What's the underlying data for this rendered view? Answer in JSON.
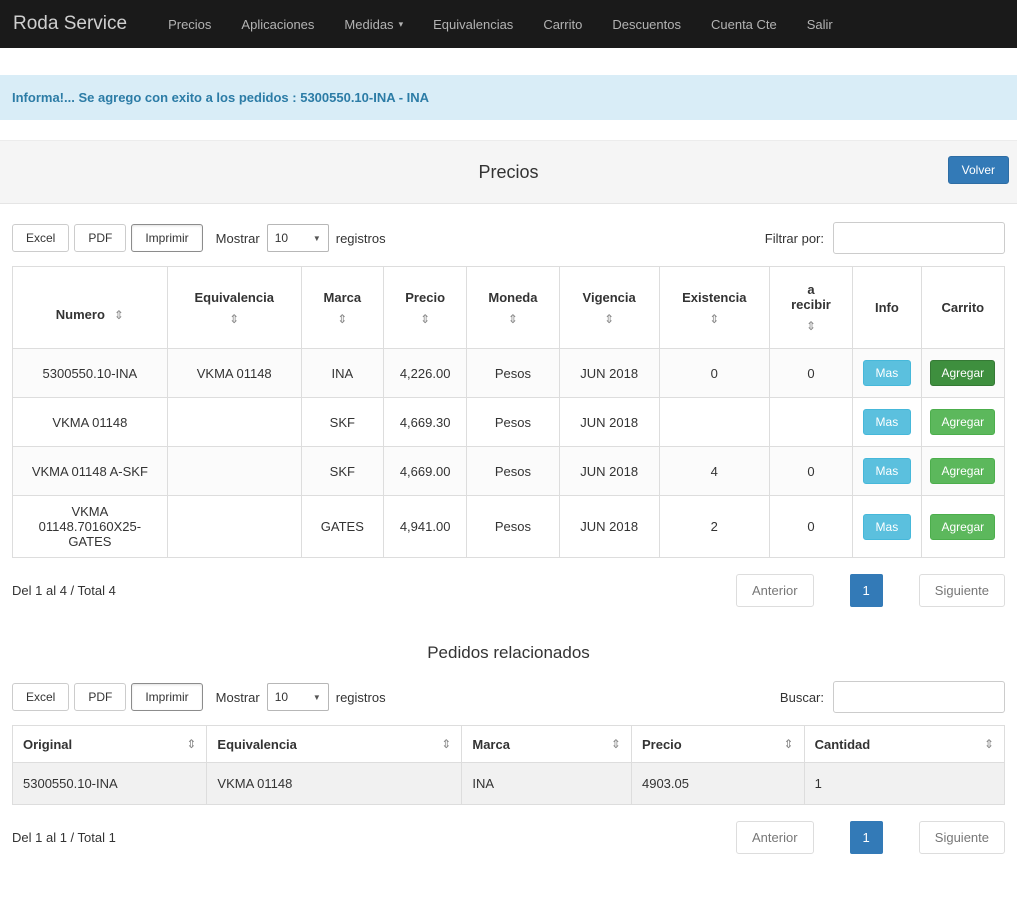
{
  "icons": {
    "caret_down": "▾",
    "select_arrow": "▼",
    "sort": "⇕"
  },
  "navbar": {
    "brand": "Roda Service",
    "items": [
      {
        "label": "Precios"
      },
      {
        "label": "Aplicaciones"
      },
      {
        "label": "Medidas"
      },
      {
        "label": "Equivalencias"
      },
      {
        "label": "Carrito"
      },
      {
        "label": "Descuentos"
      },
      {
        "label": "Cuenta Cte"
      },
      {
        "label": "Salir"
      }
    ]
  },
  "alert": {
    "message": "Informa!... Se agrego con exito a los pedidos : 5300550.10-INA - INA"
  },
  "precios": {
    "title": "Precios",
    "volver_label": "Volver",
    "toolbar": {
      "excel": "Excel",
      "pdf": "PDF",
      "imprimir": "Imprimir",
      "mostrar_label": "Mostrar",
      "page_size": "10",
      "registros_label": "registros",
      "filter_label": "Filtrar por:",
      "filter_value": ""
    },
    "table": {
      "headers": [
        "Numero",
        "Equivalencia",
        "Marca",
        "Precio",
        "Moneda",
        "Vigencia",
        "Existencia",
        "a recibir",
        "Info",
        "Carrito"
      ],
      "mas_label": "Mas",
      "agregar_label": "Agregar",
      "rows": [
        {
          "numero": "5300550.10-INA",
          "equivalencia": "VKMA 01148",
          "marca": "INA",
          "precio": "4,226.00",
          "moneda": "Pesos",
          "vigencia": "JUN 2018",
          "existencia": "0",
          "a_recibir": "0"
        },
        {
          "numero": "VKMA 01148",
          "equivalencia": "",
          "marca": "SKF",
          "precio": "4,669.30",
          "moneda": "Pesos",
          "vigencia": "JUN 2018",
          "existencia": "",
          "a_recibir": ""
        },
        {
          "numero": "VKMA 01148 A-SKF",
          "equivalencia": "",
          "marca": "SKF",
          "precio": "4,669.00",
          "moneda": "Pesos",
          "vigencia": "JUN 2018",
          "existencia": "4",
          "a_recibir": "0"
        },
        {
          "numero": "VKMA 01148.70160X25-GATES",
          "equivalencia": "",
          "marca": "GATES",
          "precio": "4,941.00",
          "moneda": "Pesos",
          "vigencia": "JUN 2018",
          "existencia": "2",
          "a_recibir": "0"
        }
      ]
    },
    "summary": "Del 1 al 4 / Total 4",
    "pagination": {
      "anterior": "Anterior",
      "page": "1",
      "siguiente": "Siguiente"
    }
  },
  "pedidos": {
    "title": "Pedidos relacionados",
    "toolbar": {
      "excel": "Excel",
      "pdf": "PDF",
      "imprimir": "Imprimir",
      "mostrar_label": "Mostrar",
      "page_size": "10",
      "registros_label": "registros",
      "buscar_label": "Buscar:",
      "buscar_value": ""
    },
    "table": {
      "headers": [
        "Original",
        "Equivalencia",
        "Marca",
        "Precio",
        "Cantidad"
      ],
      "rows": [
        {
          "original": "5300550.10-INA",
          "equivalencia": "VKMA 01148",
          "marca": "INA",
          "precio": "4903.05",
          "cantidad": "1"
        }
      ]
    },
    "summary": "Del 1 al 1 / Total 1",
    "pagination": {
      "anterior": "Anterior",
      "page": "1",
      "siguiente": "Siguiente"
    }
  }
}
